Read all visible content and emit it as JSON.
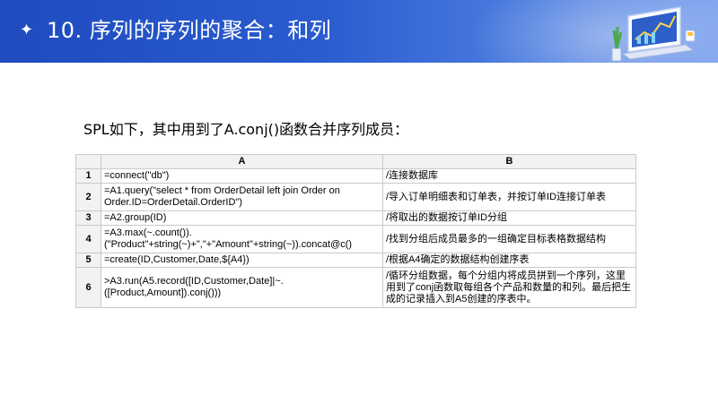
{
  "header": {
    "title": "10. 序列的序列的聚合：和列"
  },
  "intro": "SPL如下，其中用到了A.conj()函数合并序列成员：",
  "table": {
    "columns": [
      "A",
      "B"
    ],
    "rows": [
      {
        "num": "1",
        "a": "=connect(\"db\")",
        "b": "/连接数据库"
      },
      {
        "num": "2",
        "a": "=A1.query(\"select * from OrderDetail left join Order on Order.ID=OrderDetail.OrderID\")",
        "b": "/导入订单明细表和订单表，并按订单ID连接订单表"
      },
      {
        "num": "3",
        "a": "=A2.group(ID)",
        "b": "/将取出的数据按订单ID分组"
      },
      {
        "num": "4",
        "a": "=A3.max(~.count()).(\"Product\"+string(~)+\",\"+\"Amount\"+string(~)).concat@c()",
        "b": "/找到分组后成员最多的一组确定目标表格数据结构"
      },
      {
        "num": "5",
        "a": "=create(ID,Customer,Date,${A4})",
        "b": "/根据A4确定的数据结构创建序表"
      },
      {
        "num": "6",
        "a": ">A3.run(A5.record([ID,Customer,Date]|~.([Product,Amount]).conj()))",
        "b": "/循环分组数据，每个分组内将成员拼到一个序列，这里用到了conj函数取每组各个产品和数量的和列。最后把生成的记录插入到A5创建的序表中。"
      }
    ]
  }
}
